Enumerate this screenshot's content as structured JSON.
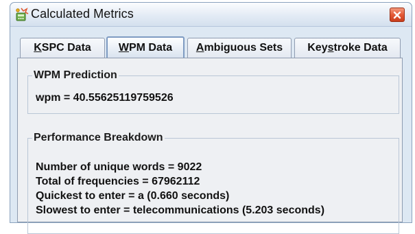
{
  "window": {
    "title": "Calculated Metrics",
    "icon": "calculator-app-icon",
    "close_icon": "close-icon"
  },
  "tabs": [
    {
      "label_prefix": "",
      "mnemonic": "K",
      "label_suffix": "SPC Data",
      "active": false
    },
    {
      "label_prefix": "",
      "mnemonic": "W",
      "label_suffix": "PM Data",
      "active": true
    },
    {
      "label_prefix": "",
      "mnemonic": "A",
      "label_suffix": "mbiguous Sets",
      "active": false
    },
    {
      "label_prefix": "Key",
      "mnemonic": "s",
      "label_suffix": "troke Data",
      "active": false
    }
  ],
  "wpm_prediction": {
    "title": "WPM Prediction",
    "value_text": "wpm = 40.55625119759526"
  },
  "performance_breakdown": {
    "title": "Performance Breakdown",
    "lines": [
      "Number of unique words = 9022",
      "Total of frequencies = 67962112",
      "Quickest to enter = a (0.660 seconds)",
      "Slowest to enter = telecommunications (5.203 seconds)"
    ]
  }
}
